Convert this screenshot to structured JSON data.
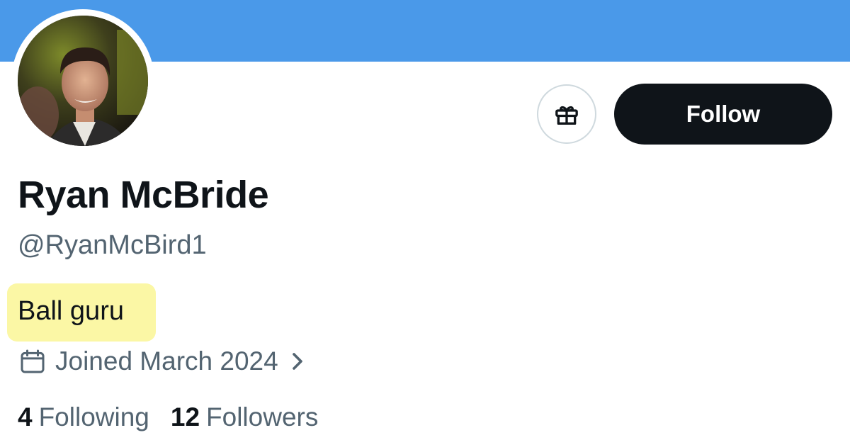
{
  "profile": {
    "display_name": "Ryan McBride",
    "handle": "@RyanMcBird1",
    "bio": "Ball guru",
    "joined": "Joined March 2024",
    "banner_color": "#4a99e9",
    "avatar_alt": "profile photo"
  },
  "actions": {
    "gift_icon": "gift-icon",
    "follow_label": "Follow"
  },
  "stats": {
    "following_count": "4",
    "following_label": "Following",
    "followers_count": "12",
    "followers_label": "Followers"
  },
  "icons": {
    "calendar": "calendar-icon",
    "chevron": "chevron-right-icon"
  },
  "colors": {
    "highlight": "#fbf7a5",
    "secondary_text": "#536471",
    "primary_text": "#0f1419"
  }
}
